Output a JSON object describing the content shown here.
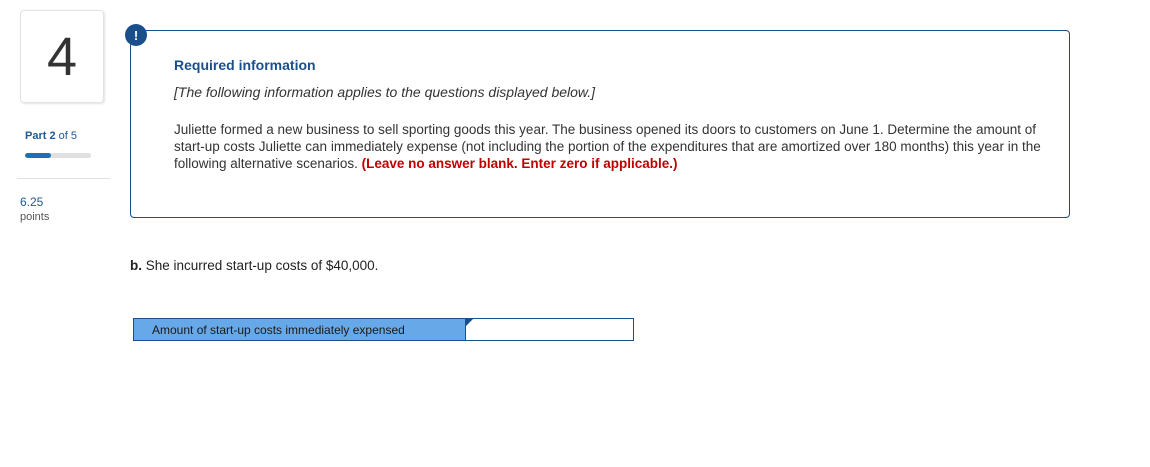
{
  "sidebar": {
    "question_number": "4",
    "part_prefix": "Part",
    "part_current": "2",
    "part_of": "of 5",
    "progress_fraction": 0.4,
    "points_value": "6.25",
    "points_label": "points"
  },
  "info": {
    "alert_glyph": "!",
    "title": "Required information",
    "subtitle": "[The following information applies to the questions displayed below.]",
    "body": "Juliette formed a new business to sell sporting goods this year. The business opened its doors to customers on June 1. Determine the amount of start-up costs Juliette can immediately expense (not including the portion of the expenditures that are amortized over 180 months) this year in the following alternative scenarios.",
    "instruction": "(Leave no answer blank. Enter zero if applicable.)"
  },
  "question": {
    "letter": "b.",
    "text": "She incurred start-up costs of $40,000."
  },
  "answer": {
    "label": "Amount of start-up costs immediately expensed",
    "value": ""
  },
  "colors": {
    "brand": "#1b4f8c",
    "label_bg": "#66a8e8",
    "emphasis": "#c00000"
  }
}
